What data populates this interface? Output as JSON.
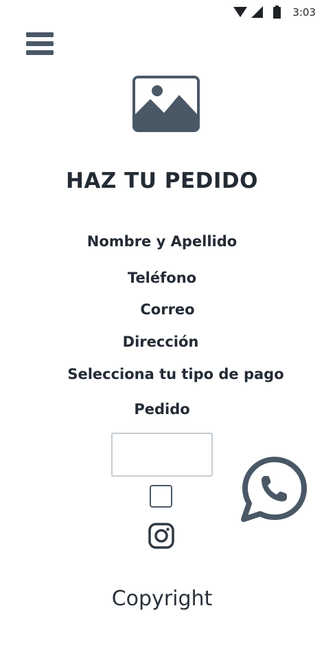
{
  "status_bar": {
    "time": "3:03",
    "icons": [
      "wifi-icon",
      "signal-icon",
      "battery-icon"
    ]
  },
  "header": {
    "menu_icon": "hamburger-menu-icon"
  },
  "hero": {
    "icon": "image-placeholder-icon"
  },
  "form": {
    "title": "HAZ TU PEDIDO",
    "labels": {
      "name": "Nombre y Apellido",
      "phone": "Teléfono",
      "email": "Correo",
      "address": "Dirección",
      "payment": "Selecciona tu tipo de pago",
      "order": "Pedido"
    },
    "order_input_value": "",
    "checkbox_checked": false
  },
  "social": {
    "instagram_icon": "instagram-icon",
    "whatsapp_icon": "whatsapp-icon"
  },
  "footer": {
    "copyright": "Copyright"
  },
  "colors": {
    "text": "#232b35",
    "icon": "#4a5866",
    "input_border": "#c4ccd2",
    "background": "#ffffff"
  }
}
